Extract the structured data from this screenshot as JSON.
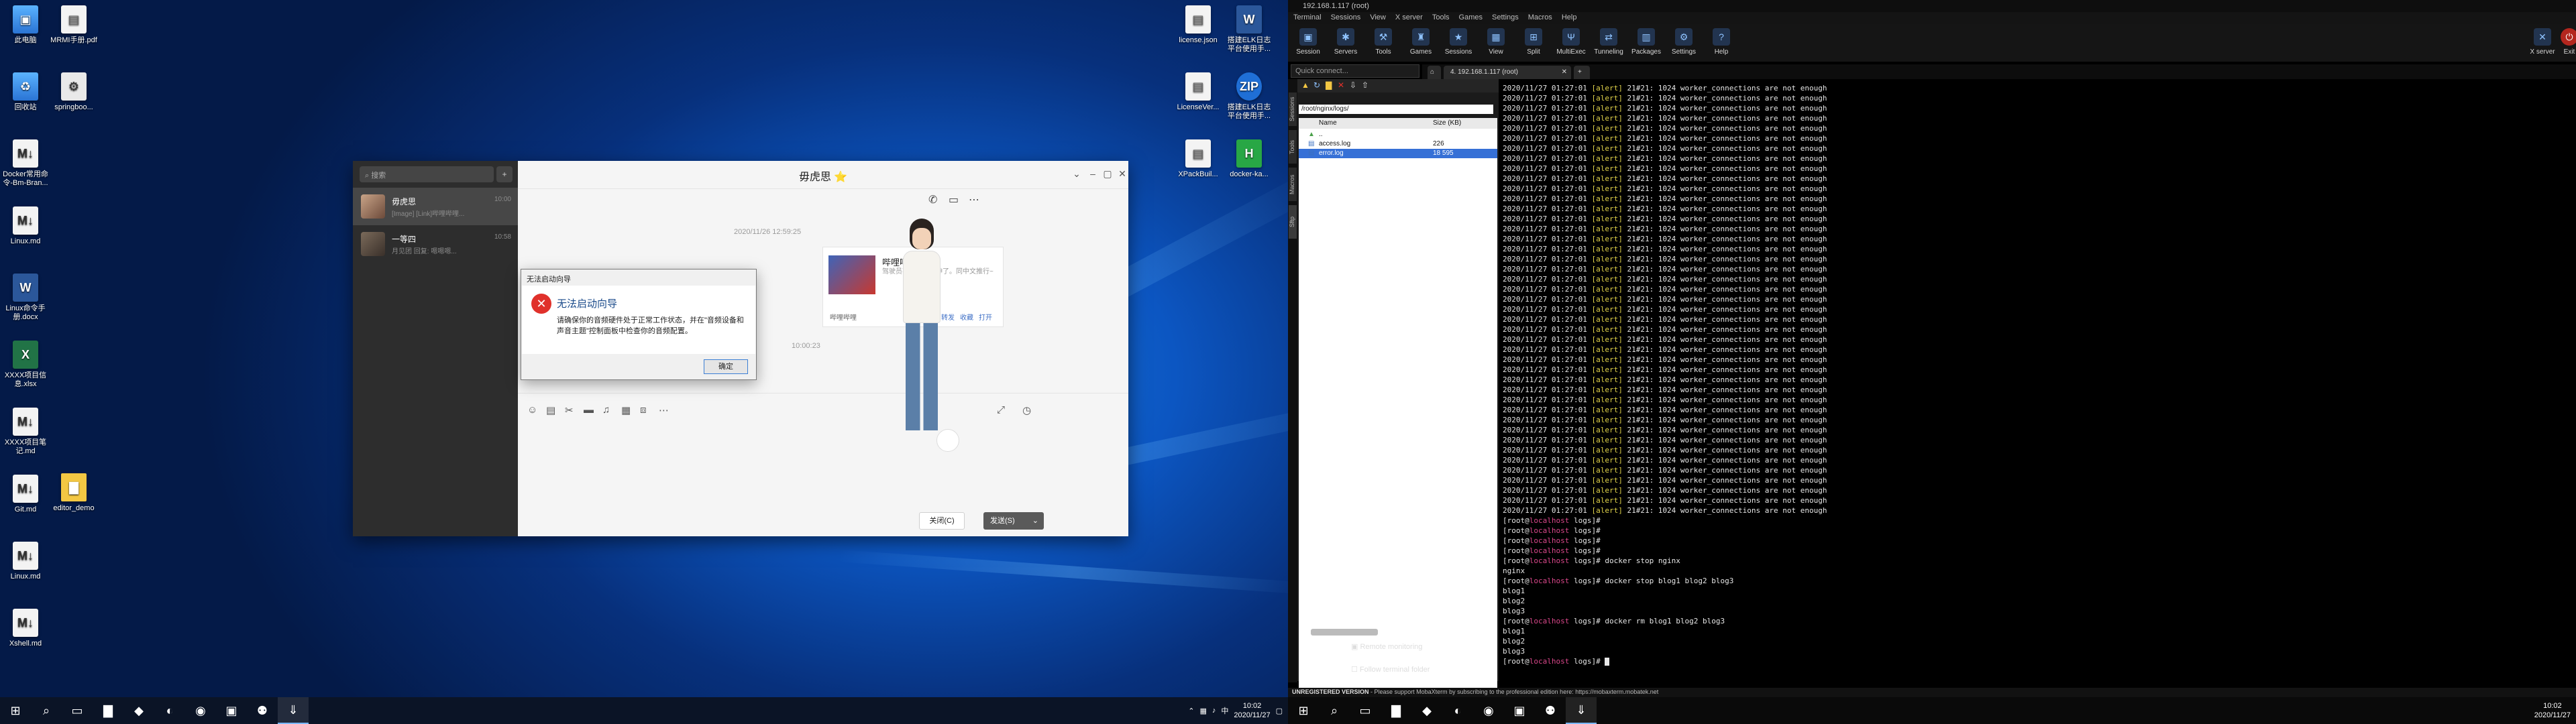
{
  "desktop": {
    "left_icons": [
      {
        "label": "此电脑",
        "glyph": "▣",
        "kind": "pc"
      },
      {
        "label": "回收站",
        "glyph": "♻",
        "kind": "pc"
      },
      {
        "label": "Docker常用命令-Bm-Bran...",
        "glyph": "M↓",
        "kind": "md"
      },
      {
        "label": "Linux.md",
        "glyph": "M↓",
        "kind": "md"
      },
      {
        "label": "Linux命令手册.docx",
        "glyph": "W",
        "kind": "doc"
      },
      {
        "label": "XXXX项目信息.xlsx",
        "glyph": "X",
        "kind": "xls"
      },
      {
        "label": "XXXX项目笔记.md",
        "glyph": "M↓",
        "kind": "md"
      },
      {
        "label": "Git.md",
        "glyph": "M↓",
        "kind": "md"
      },
      {
        "label": "Linux.md",
        "glyph": "M↓",
        "kind": "md"
      },
      {
        "label": "Xshell.md",
        "glyph": "M↓",
        "kind": "md"
      }
    ],
    "second_col_icons": [
      {
        "label": "MRMI手册.pdf",
        "glyph": "▤",
        "kind": "file"
      },
      {
        "label": "springboo...",
        "glyph": "⚙",
        "kind": "tool"
      },
      {
        "label": "editor_demo",
        "glyph": "▇",
        "kind": "folder"
      }
    ],
    "right_icons": [
      {
        "label": "license.json",
        "glyph": "▤",
        "kind": "file"
      },
      {
        "label": "搭建ELK日志平台使用手...",
        "glyph": "W",
        "kind": "doc"
      },
      {
        "label": "LicenseVer...",
        "glyph": "▤",
        "kind": "file"
      },
      {
        "label": "搭建ELK日志平台使用手...",
        "glyph": "ZIP",
        "kind": "zip"
      },
      {
        "label": "XPackBuil...",
        "glyph": "▤",
        "kind": "file"
      },
      {
        "label": "docker-ka...",
        "glyph": "H",
        "kind": "h"
      }
    ]
  },
  "chat": {
    "search_placeholder": "搜索",
    "title": "毋虎思 ⭐",
    "conversations": [
      {
        "name": "毋虎思",
        "preview": "[Image] [Link]哔哩哔哩...",
        "time": "10:00"
      },
      {
        "name": "一等四",
        "preview": "月见团 回复: 嗯嗯嗯...",
        "time": "10:58"
      }
    ],
    "timestamp1": "2020/11/26 12:59:25",
    "timestamp2": "10:00:23",
    "card": {
      "title": "哔哩哔哩",
      "subtitle": "驾驶员不来了，提神了。同中文推行~",
      "source": "哔哩哔哩",
      "a1": "转发",
      "a2": "收藏",
      "a3": "打开"
    },
    "close_label": "关闭(C)",
    "send_label": "发送(S)"
  },
  "dialog": {
    "title": "无法启动向导",
    "heading": "无法启动向导",
    "message": "请确保你的音频硬件处于正常工作状态，并在\"音频设备和声音主题\"控制面板中检查你的音频配置。",
    "ok": "确定"
  },
  "taskbar_left": {
    "time": "10:02",
    "date": "2020/11/27",
    "ime": "中"
  },
  "moba": {
    "title": "192.168.1.117 (root)",
    "menu": [
      "Terminal",
      "Sessions",
      "View",
      "X server",
      "Tools",
      "Games",
      "Settings",
      "Macros",
      "Help"
    ],
    "tools": [
      {
        "label": "Session",
        "glyph": "▣"
      },
      {
        "label": "Servers",
        "glyph": "✱"
      },
      {
        "label": "Tools",
        "glyph": "⚒"
      },
      {
        "label": "Games",
        "glyph": "♜"
      },
      {
        "label": "Sessions",
        "glyph": "★"
      },
      {
        "label": "View",
        "glyph": "▦"
      },
      {
        "label": "Split",
        "glyph": "⊞"
      },
      {
        "label": "MultiExec",
        "glyph": "Ψ"
      },
      {
        "label": "Tunneling",
        "glyph": "⇄"
      },
      {
        "label": "Packages",
        "glyph": "▥"
      },
      {
        "label": "Settings",
        "glyph": "⚙"
      },
      {
        "label": "Help",
        "glyph": "?"
      }
    ],
    "xserver_label": "X server",
    "exit_label": "Exit",
    "quick_connect": "Quick connect...",
    "tab_label": "4. 192.168.1.117 (root)",
    "side_tabs": [
      "Sessions",
      "Tools",
      "Macros",
      "Sftp"
    ],
    "sftp_path": "/root/nginx/logs/",
    "sftp_headers": {
      "name": "Name",
      "size": "Size (KB)"
    },
    "sftp_files": [
      {
        "name": "..",
        "size": ""
      },
      {
        "name": "access.log",
        "size": "226"
      },
      {
        "name": "error.log",
        "size": "18 595"
      }
    ],
    "remote_monitoring": "Remote monitoring",
    "follow_folder": "Follow terminal folder",
    "alert_line": {
      "ts": "2020/11/27 01:27:01",
      "level": "[alert]",
      "msg": "21#21: 1024 worker_connections are not enough"
    },
    "alert_count": 43,
    "prompt": {
      "open": "[root@",
      "host": "localhost",
      "rest": " logs]# "
    },
    "session": [
      {
        "prompt": true,
        "text": ""
      },
      {
        "prompt": true,
        "text": ""
      },
      {
        "prompt": true,
        "text": ""
      },
      {
        "prompt": true,
        "text": ""
      },
      {
        "prompt": true,
        "text": "docker stop nginx"
      },
      {
        "prompt": false,
        "text": "nginx"
      },
      {
        "prompt": true,
        "text": "docker stop blog1 blog2 blog3"
      },
      {
        "prompt": false,
        "text": "blog1"
      },
      {
        "prompt": false,
        "text": "blog2"
      },
      {
        "prompt": false,
        "text": "blog3"
      },
      {
        "prompt": true,
        "text": "docker rm blog1 blog2 blog3"
      },
      {
        "prompt": false,
        "text": "blog1"
      },
      {
        "prompt": false,
        "text": "blog2"
      },
      {
        "prompt": false,
        "text": "blog3"
      },
      {
        "prompt": true,
        "text": "",
        "cursor": true
      }
    ],
    "status_bold": "UNREGISTERED VERSION",
    "status_text": " - Please support MobaXterm by subscribing to the professional edition here: https://mobaxterm.mobatek.net",
    "taskbar_time": "10:02",
    "taskbar_date": "2020/11/27"
  }
}
